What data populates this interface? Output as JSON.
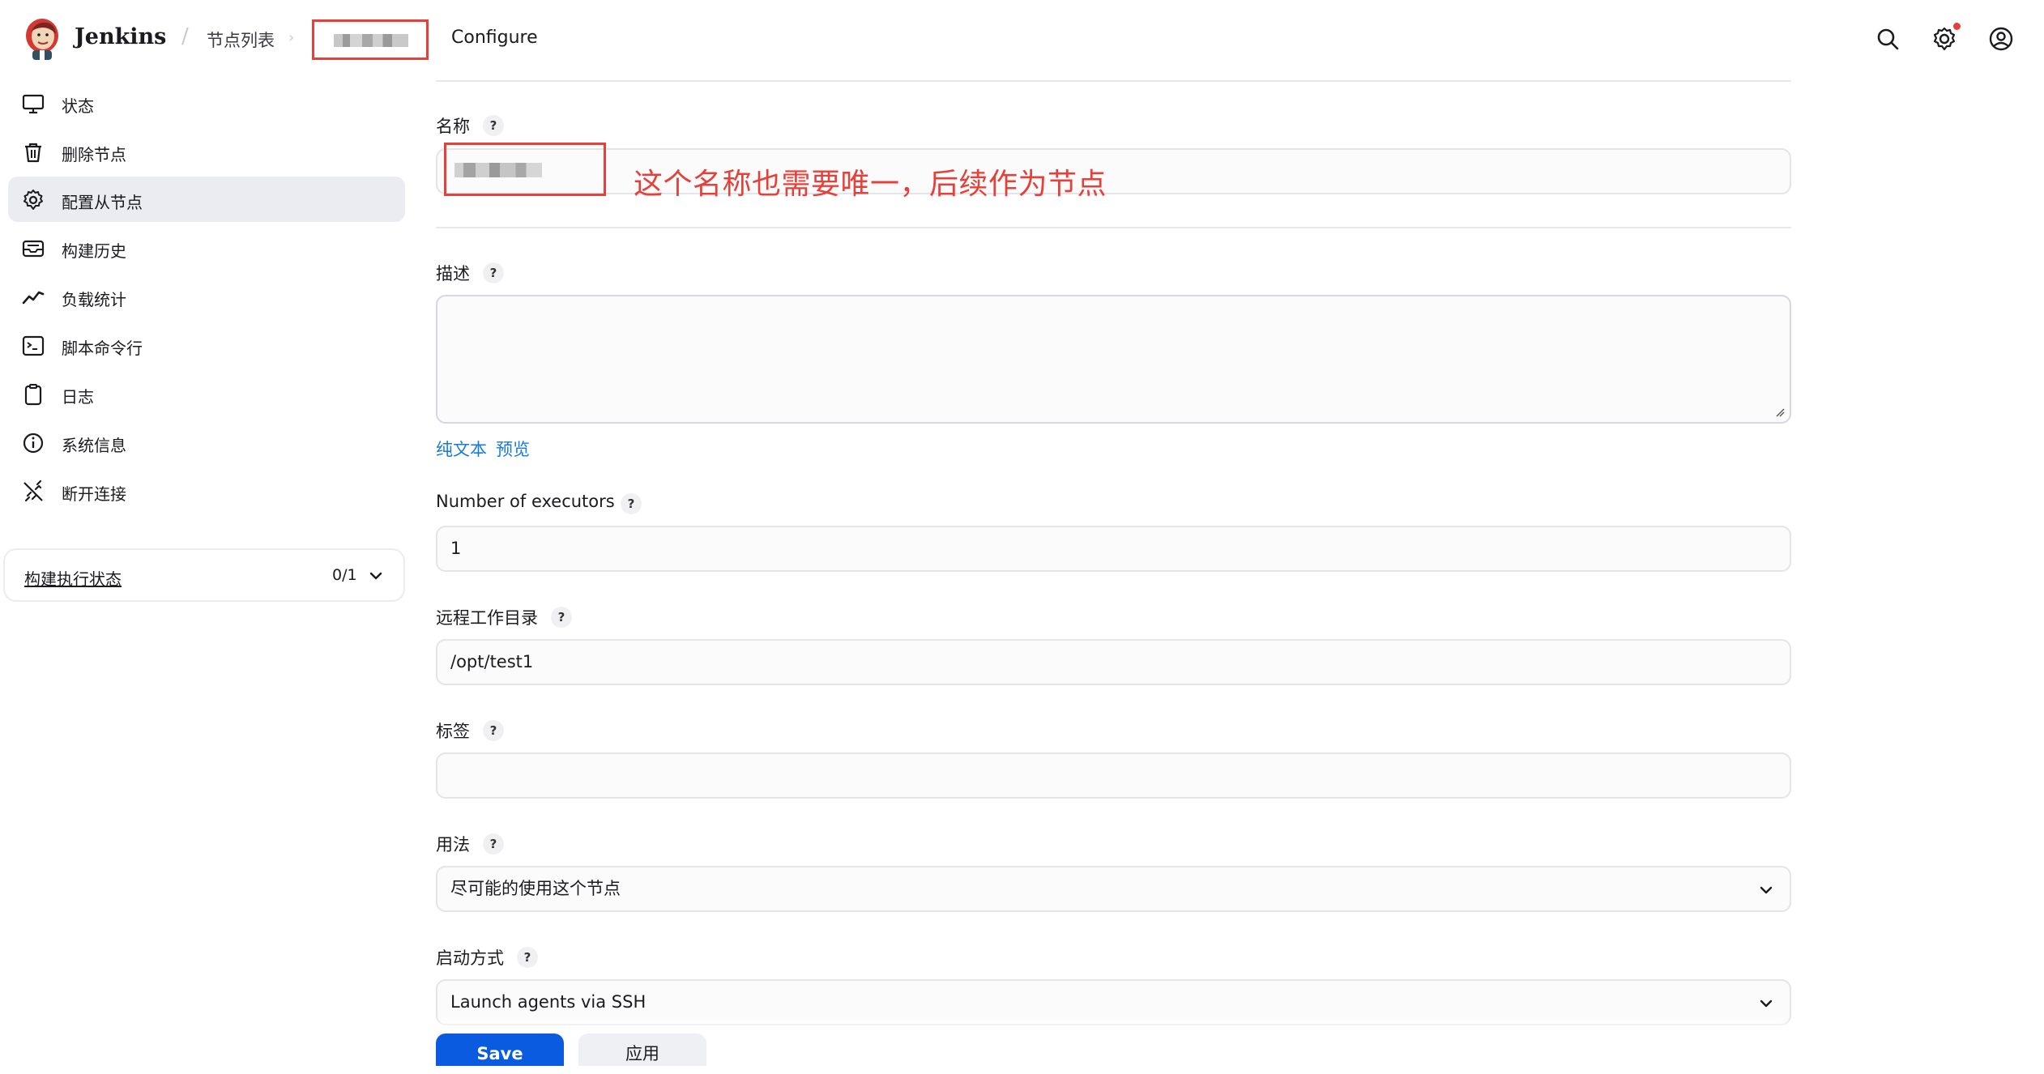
{
  "header": {
    "brand": "Jenkins",
    "breadcrumb_nodes": "节点列表",
    "breadcrumb_current": "Configure",
    "icons": [
      "search-icon",
      "gear-icon",
      "user-icon"
    ],
    "notification_color": "#e5403a"
  },
  "sidebar": {
    "items": [
      {
        "label": "状态",
        "icon": "monitor-icon"
      },
      {
        "label": "删除节点",
        "icon": "trash-icon"
      },
      {
        "label": "配置从节点",
        "icon": "gear-icon",
        "active": true
      },
      {
        "label": "构建历史",
        "icon": "inbox-icon"
      },
      {
        "label": "负载统计",
        "icon": "trend-icon"
      },
      {
        "label": "脚本命令行",
        "icon": "terminal-icon"
      },
      {
        "label": "日志",
        "icon": "clipboard-icon"
      },
      {
        "label": "系统信息",
        "icon": "info-icon"
      },
      {
        "label": "断开连接",
        "icon": "disconnect-icon"
      }
    ],
    "executor_status": {
      "label": "构建执行状态",
      "count": "0/1"
    }
  },
  "form": {
    "name": {
      "label": "名称",
      "help": "?"
    },
    "annotation": "这个名称也需要唯一，后续作为节点",
    "description": {
      "label": "描述",
      "help": "?",
      "value": ""
    },
    "format": {
      "plain_text": "纯文本",
      "preview": "预览"
    },
    "executors": {
      "label": "Number of executors",
      "help": "?",
      "value": "1"
    },
    "remote_dir": {
      "label": "远程工作目录",
      "help": "?",
      "value": "/opt/test1"
    },
    "labels": {
      "label": "标签",
      "help": "?",
      "value": ""
    },
    "usage": {
      "label": "用法",
      "help": "?",
      "value": "尽可能的使用这个节点"
    },
    "launch": {
      "label": "启动方式",
      "help": "?",
      "value": "Launch agents via SSH"
    }
  },
  "buttons": {
    "save": "Save",
    "apply": "应用"
  },
  "colors": {
    "accent": "#0b5be1",
    "link": "#1a7bd6",
    "annotation": "#e5403a",
    "active_bg": "#eaecf1"
  }
}
